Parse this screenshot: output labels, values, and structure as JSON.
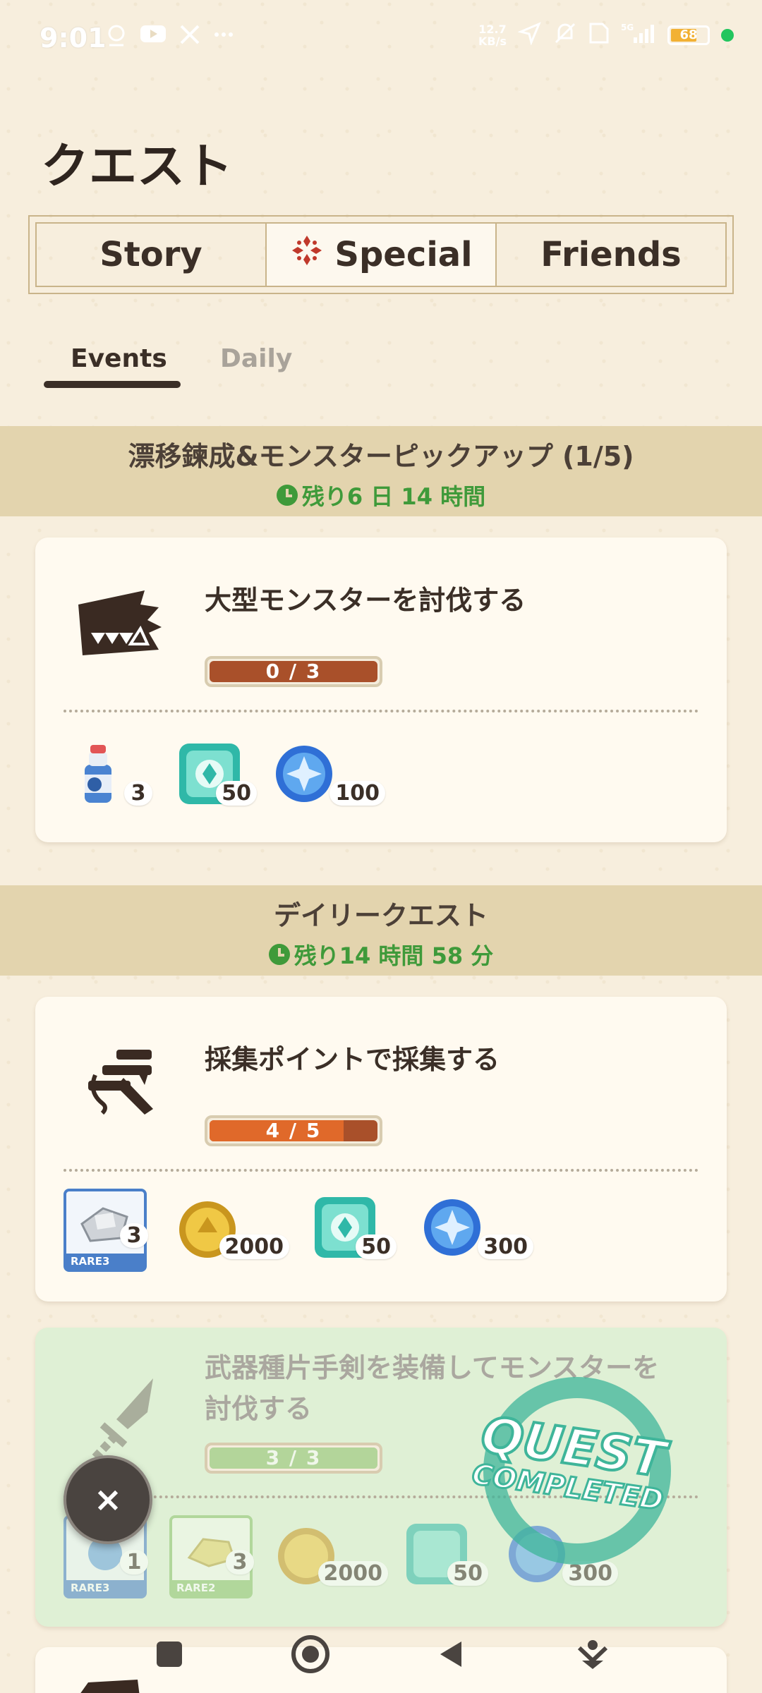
{
  "status_bar": {
    "time": "9:01",
    "speed_top": "12.7",
    "speed_bottom": "KB/s",
    "battery": "68"
  },
  "page": {
    "title": "クエスト"
  },
  "segmented_tabs": [
    {
      "label": "Story"
    },
    {
      "label": "Special",
      "active": true
    },
    {
      "label": "Friends"
    }
  ],
  "sub_tabs": {
    "events": "Events",
    "daily": "Daily",
    "active": "Events"
  },
  "sections": [
    {
      "title": "漂移鍊成&モンスターピックアップ (1/5)",
      "time_left": "残り6 日 14 時間",
      "quests": [
        {
          "title": "大型モンスターを討伐する",
          "progress_text": "0 / 3",
          "progress": 0.0,
          "icon": "monster-jaw-icon",
          "rewards": [
            {
              "icon": "potion-icon",
              "count": "3"
            },
            {
              "icon": "green-crest-gem-icon",
              "count": "50"
            },
            {
              "icon": "blue-orb-icon",
              "count": "100"
            }
          ]
        }
      ]
    },
    {
      "title": "デイリークエスト",
      "time_left": "残り14 時間 58 分",
      "quests": [
        {
          "title": "採集ポイントで採集する",
          "progress_text": "4 / 5",
          "progress": 0.8,
          "icon": "gathering-icon",
          "rewards": [
            {
              "icon": "ore-material-icon",
              "count": "3",
              "rarity": "RARE3"
            },
            {
              "icon": "gold-coin-icon",
              "count": "2000"
            },
            {
              "icon": "green-crest-gem-icon",
              "count": "50"
            },
            {
              "icon": "blue-orb-icon",
              "count": "300"
            }
          ]
        },
        {
          "title": "武器種片手剣を装備してモンスターを討伐する",
          "progress_text": "3 / 3",
          "progress": 1.0,
          "completed": true,
          "stamp_line1": "QUEST",
          "stamp_line2": "COMPLETED",
          "icon": "sword-icon",
          "rewards": [
            {
              "icon": "blue-material-icon",
              "count": "1",
              "rarity": "RARE3"
            },
            {
              "icon": "yellow-material-icon",
              "count": "3",
              "rarity": "RARE2"
            },
            {
              "icon": "gold-coin-icon",
              "count": "2000"
            },
            {
              "icon": "green-crest-gem-icon",
              "count": "50"
            },
            {
              "icon": "blue-orb-icon",
              "count": "300"
            }
          ]
        }
      ]
    }
  ],
  "close_button": {
    "label": "×"
  },
  "colors": {
    "background": "#f7eedd",
    "section_band": "#e3d4ae",
    "timer_green": "#3f9a3a",
    "progress_orange": "#e0692a",
    "completed_card": "#dff0d5"
  }
}
